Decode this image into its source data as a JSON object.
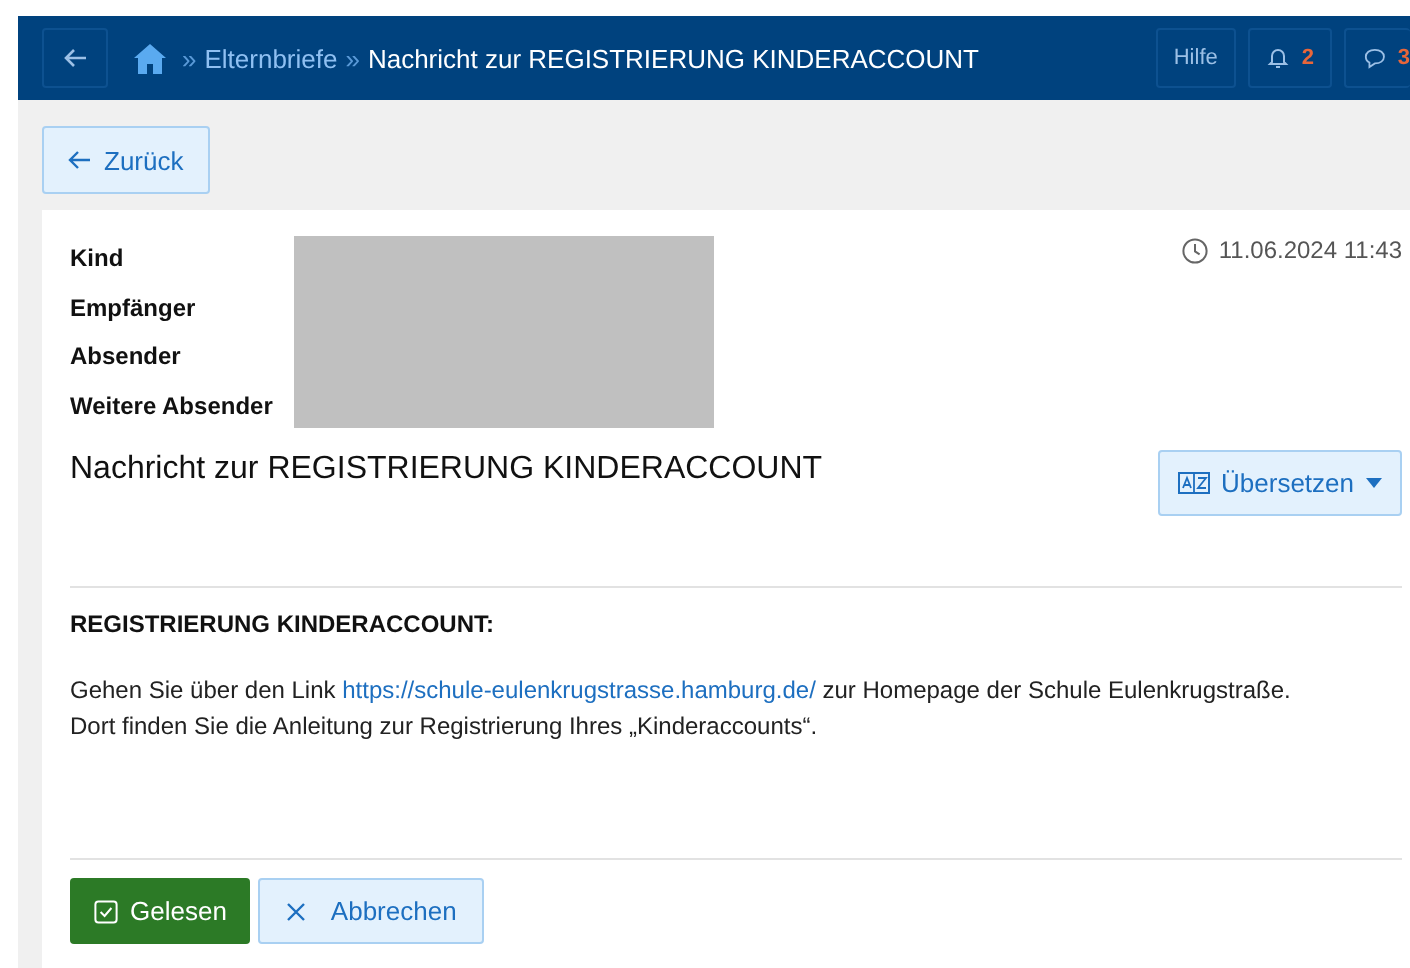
{
  "navbar": {
    "breadcrumbs": [
      {
        "separator": "»",
        "label": "Elternbriefe"
      },
      {
        "separator": "»",
        "label": "Nachricht zur REGISTRIERUNG KINDERACCOUNT"
      }
    ],
    "help": "Hilfe",
    "notifications": "2",
    "messages": "3"
  },
  "back_button": "Zurück",
  "message": {
    "fields": [
      {
        "label": "Kind"
      },
      {
        "label": "Empfänger"
      },
      {
        "label": "Absender"
      },
      {
        "label": "Weitere Absender"
      }
    ],
    "timestamp": "11.06.2024 11:43",
    "title": "Nachricht zur REGISTRIERUNG KINDERACCOUNT",
    "translate_button": "Übersetzen",
    "heading": "REGISTRIERUNG KINDERACCOUNT:",
    "body": {
      "before": "Gehen Sie über den Link ",
      "link": "https://schule-eulenkrugstrasse.hamburg.de/",
      "after": " zur Homepage der Schule Eulenkrugstraße.",
      "line2": "Dort finden Sie die Anleitung zur Registrierung Ihres „Kinderaccounts“."
    }
  },
  "actions": {
    "read": "Gelesen",
    "cancel": "Abbrechen"
  }
}
